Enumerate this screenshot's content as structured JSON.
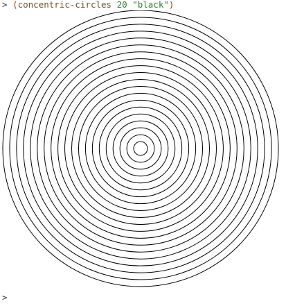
{
  "repl": {
    "prompt": ">",
    "command": {
      "open_paren": "(",
      "function": "concentric-circles",
      "count": "20",
      "color": "\"black\"",
      "close_paren": ")"
    },
    "next_prompt": ">"
  },
  "output": {
    "shape": "concentric-circles",
    "circle_count": 20,
    "stroke_color": "#000000"
  }
}
